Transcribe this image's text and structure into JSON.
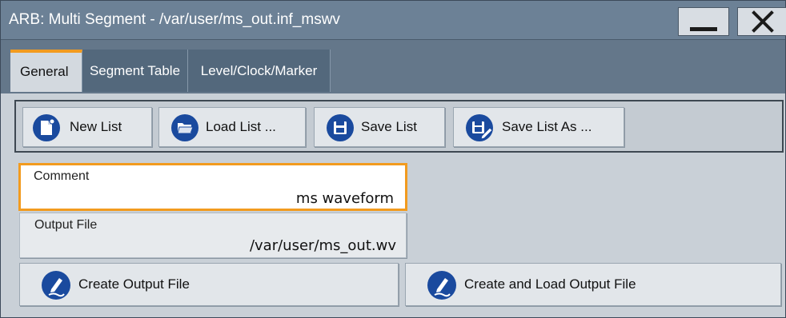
{
  "window": {
    "title": "ARB: Multi Segment - /var/user/ms_out.inf_mswv",
    "minimize_icon": "minimize-icon",
    "close_icon": "close-icon"
  },
  "tabs": [
    {
      "label": "General",
      "active": true
    },
    {
      "label": "Segment Table",
      "active": false
    },
    {
      "label": "Level/Clock/Marker",
      "active": false
    }
  ],
  "toolbar": {
    "new_list": {
      "label": "New List",
      "icon": "new-document-icon"
    },
    "load_list": {
      "label": "Load List ...",
      "icon": "folder-open-icon"
    },
    "save_list": {
      "label": "Save List",
      "icon": "floppy-disk-icon"
    },
    "save_list_as": {
      "label": "Save List As ...",
      "icon": "floppy-disk-edit-icon"
    }
  },
  "comment": {
    "label": "Comment",
    "value": "ms waveform"
  },
  "output_file": {
    "label": "Output File",
    "value": "/var/user/ms_out.wv"
  },
  "actions": {
    "create_output": {
      "label": "Create Output File",
      "icon": "pen-icon"
    },
    "create_and_load": {
      "label": "Create and Load Output File",
      "icon": "pen-icon"
    }
  },
  "colors": {
    "accent": "#f29b1f",
    "icon_circle": "#1a4a9e",
    "titlebar": "#6c8196",
    "tabstrip": "#64778a"
  }
}
